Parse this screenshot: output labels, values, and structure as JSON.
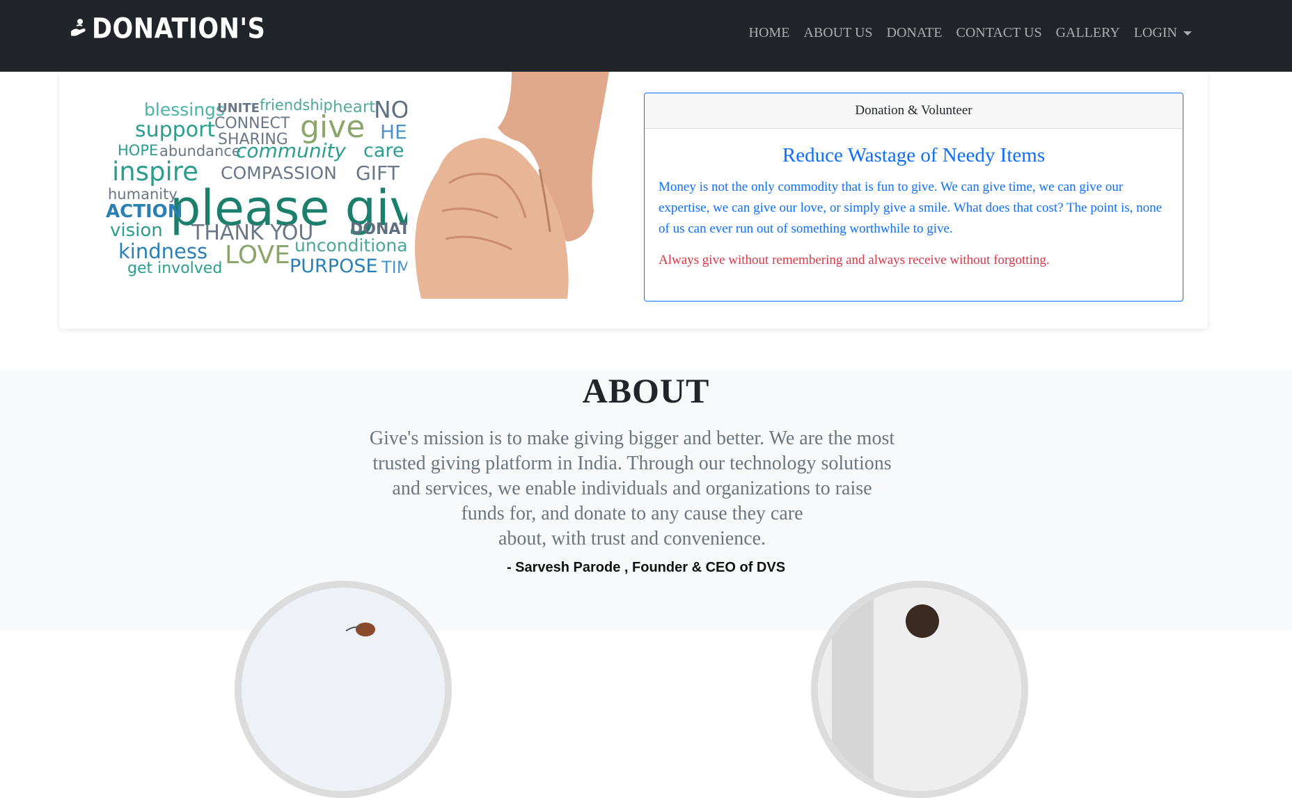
{
  "brand": {
    "name": "DONATION'S",
    "logo_icon": "giving-hand-icon"
  },
  "nav": {
    "items": [
      {
        "label": "HOME"
      },
      {
        "label": "ABOUT US"
      },
      {
        "label": "DONATE"
      },
      {
        "label": "CONTACT US"
      },
      {
        "label": "GALLERY"
      },
      {
        "label": "LOGIN",
        "dropdown": true
      }
    ]
  },
  "hero": {
    "word_cloud": [
      "blessings",
      "UNITE",
      "friendship",
      "heart",
      "NOW",
      "support",
      "CONNECT",
      "give",
      "HELP",
      "SHARING",
      "HOPE",
      "abundance",
      "community",
      "care",
      "inspire",
      "COMPASSION",
      "GIFT",
      "humanity",
      "please give",
      "ACTION",
      "vision",
      "THANK YOU",
      "DONATE",
      "kindness",
      "LOVE",
      "unconditional",
      "get involved",
      "PURPOSE",
      "TIME"
    ],
    "card": {
      "header": "Donation & Volunteer",
      "title": "Reduce Wastage of Needy Items",
      "text": "Money is not the only commodity that is fun to give. We can give time, we can give our expertise, we can give our love, or simply give a smile. What does that cost? The point is, none of us can ever run out of something worthwhile to give.",
      "quote": "Always give without remembering and always receive without forgotting."
    }
  },
  "about": {
    "title": "ABOUT",
    "lines": [
      "Give's mission is to make giving bigger and better. We are the most",
      "trusted giving platform in India. Through our technology solutions",
      "and services, we enable individuals and organizations to raise",
      "funds for, and donate to any cause they care",
      "about, with trust and convenience."
    ],
    "founder": "- Sarvesh Parode , Founder & CEO of DVS"
  },
  "colors": {
    "navbar": "#212529",
    "accent": "#0d6efd",
    "quote": "#dc3545",
    "muted": "#6c757d",
    "section_bg": "#f8f9fa"
  }
}
